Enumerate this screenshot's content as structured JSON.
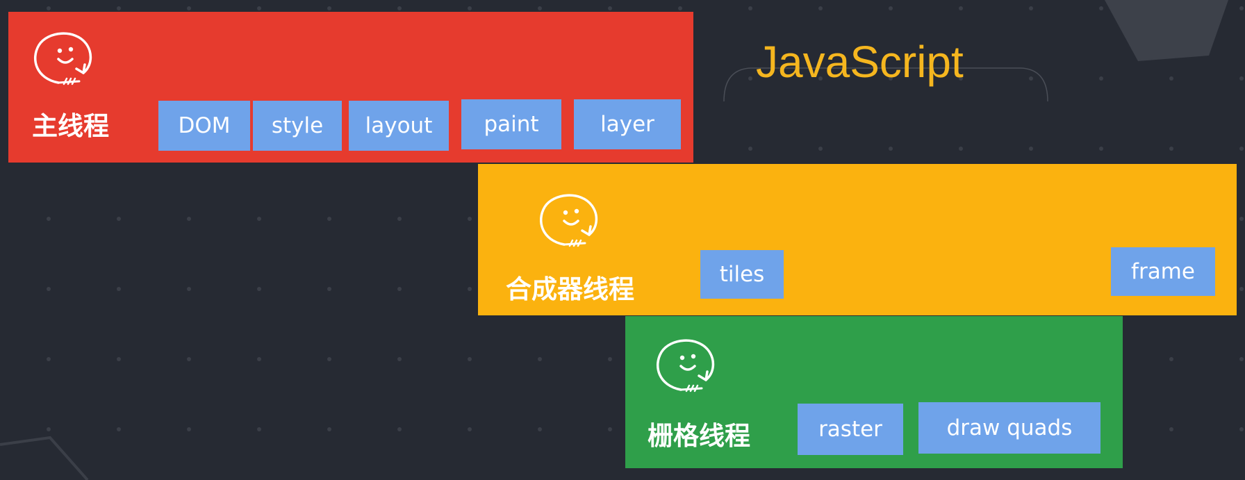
{
  "colors": {
    "background": "#262a33",
    "main_thread": "#e63b2e",
    "compositor_thread": "#fbb20f",
    "raster_thread": "#2f9f4a",
    "task_chip": "#6fa3ea",
    "javascript_label": "#f5b61f"
  },
  "javascript_label": "JavaScript",
  "main_thread": {
    "name": "主线程",
    "icon": "smiley-balloon-icon",
    "tasks": [
      "DOM",
      "style",
      "layout",
      "paint",
      "layer"
    ]
  },
  "compositor_thread": {
    "name": "合成器线程",
    "icon": "smiley-balloon-icon",
    "tasks": [
      "tiles",
      "frame"
    ]
  },
  "raster_thread": {
    "name": "栅格线程",
    "icon": "smiley-balloon-icon",
    "tasks": [
      "raster",
      "draw quads"
    ]
  }
}
